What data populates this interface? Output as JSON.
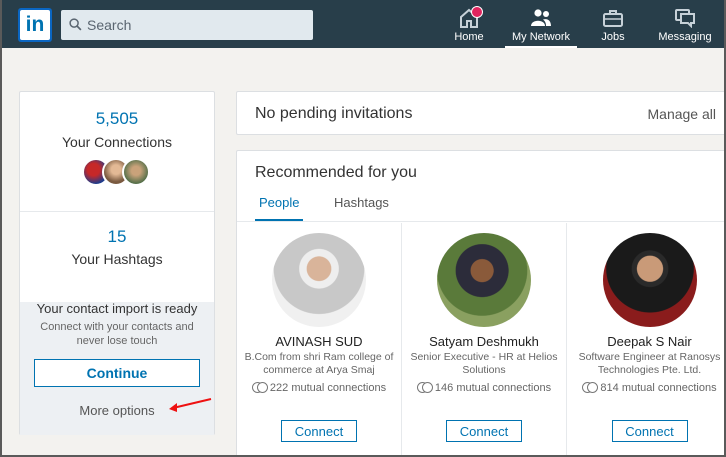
{
  "nav": {
    "logo": "in",
    "search_placeholder": "Search",
    "items": [
      {
        "label": "Home",
        "icon": "home-icon",
        "has_badge": true
      },
      {
        "label": "My Network",
        "icon": "network-icon",
        "active": true
      },
      {
        "label": "Jobs",
        "icon": "briefcase-icon"
      },
      {
        "label": "Messaging",
        "icon": "messaging-icon"
      }
    ]
  },
  "left": {
    "connections_count": "5,505",
    "connections_label": "Your Connections",
    "hashtags_count": "15",
    "hashtags_label": "Your Hashtags",
    "import_title": "Your contact import is ready",
    "import_sub": "Connect with your contacts and never lose touch",
    "continue_label": "Continue",
    "more_options_label": "More options"
  },
  "invitations": {
    "title": "No pending invitations",
    "manage_label": "Manage all"
  },
  "recommended": {
    "title": "Recommended for you",
    "tabs": [
      "People",
      "Hashtags"
    ],
    "people": [
      {
        "name": "AVINASH SUD",
        "info": "B.Com from shri Ram college of commerce at Arya Smaj",
        "mutual": "222 mutual connections",
        "connect": "Connect"
      },
      {
        "name": "Satyam Deshmukh",
        "info": "Senior Executive - HR at Helios Solutions",
        "mutual": "146 mutual connections",
        "connect": "Connect"
      },
      {
        "name": "Deepak S Nair",
        "info": "Software Engineer at Ranosys Technologies Pte. Ltd.",
        "mutual": "814 mutual connections",
        "connect": "Connect"
      }
    ]
  },
  "colors": {
    "nav_bg": "#283e4a",
    "accent": "#0073b1",
    "page_bg": "#f3f2ef"
  }
}
